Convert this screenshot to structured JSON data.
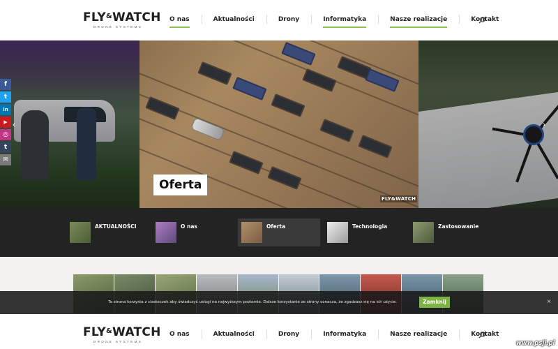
{
  "brand": {
    "logo_text_1": "FLY",
    "logo_amp": "&",
    "logo_text_2": "WATCH",
    "logo_sub": "DRONE SYSTEMS"
  },
  "nav": {
    "items": [
      {
        "label": "O nas",
        "active": true
      },
      {
        "label": "Aktualności"
      },
      {
        "label": "Drony"
      },
      {
        "label": "Informatyka"
      },
      {
        "label": "Nasze realizacje"
      },
      {
        "label": "Kontakt"
      }
    ],
    "search_icon": "search-icon"
  },
  "hero": {
    "caption": "Oferta",
    "watermark": "FLY&WATCH",
    "prev_icon": "chevron-left-icon",
    "next_icon": "chevron-right-icon"
  },
  "social": [
    {
      "name": "facebook-icon",
      "glyph": "f",
      "color": "#3b5998"
    },
    {
      "name": "twitter-icon",
      "glyph": "t",
      "color": "#1da1f2"
    },
    {
      "name": "linkedin-icon",
      "glyph": "in",
      "color": "#0077b5"
    },
    {
      "name": "youtube-icon",
      "glyph": "▶",
      "color": "#cc181e"
    },
    {
      "name": "instagram-icon",
      "glyph": "◎",
      "color": "#c13584"
    },
    {
      "name": "tumblr-icon",
      "glyph": "t",
      "color": "#35465c"
    },
    {
      "name": "email-icon",
      "glyph": "✉",
      "color": "#7a7a7a"
    }
  ],
  "tabs": [
    {
      "label": "AKTUALNOŚCI",
      "thumb": "#5b6e3e"
    },
    {
      "label": "O nas",
      "thumb": "#9a4fb0"
    },
    {
      "label": "Oferta",
      "thumb": "#9a7b58",
      "active": true
    },
    {
      "label": "Technologia",
      "thumb": "#d8d8d8"
    },
    {
      "label": "Zastosowanie",
      "thumb": "#6d7a56"
    }
  ],
  "gallery": [
    "#6b7a4e",
    "#556b4a",
    "#7c8a5c",
    "#a9acb0",
    "#8da0b8",
    "#9aa6ae",
    "#5f7a8c",
    "#a8423b",
    "#4d6a7c",
    "#6f8a6a"
  ],
  "cookie": {
    "text": "Ta strona korzysta z ciasteczek aby świadczyć usługi na najwyższym poziomie. Dalsze korzystanie ze strony oznacza, że zgadzasz się na ich użycie.",
    "accept": "Zamknij",
    "close": "×"
  },
  "footer_watermark": "www.psji.pl",
  "colors": {
    "accent": "#8bc34a",
    "dark": "#232323"
  }
}
